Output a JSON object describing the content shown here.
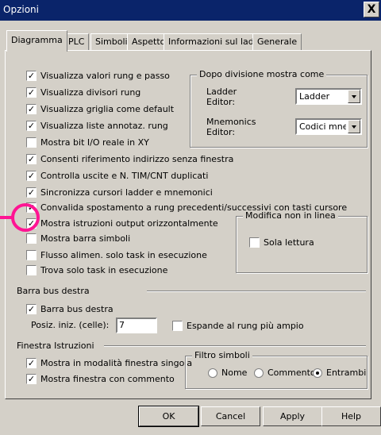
{
  "window": {
    "title": "Opzioni",
    "close_glyph": "X"
  },
  "tabs": [
    {
      "label": "Diagramma"
    },
    {
      "label": "PLC"
    },
    {
      "label": "Simboli"
    },
    {
      "label": "Aspetto"
    },
    {
      "label": "Informazioni sul ladder"
    },
    {
      "label": "Generale"
    }
  ],
  "options": [
    {
      "label": "Visualizza valori rung e passo",
      "checked": true
    },
    {
      "label": "Visualizza divisori rung",
      "checked": true
    },
    {
      "label": "Visualizza griglia come default",
      "checked": true
    },
    {
      "label": "Visualizza liste annotaz. rung",
      "checked": true
    },
    {
      "label": "Mostra bit I/O reale in XY",
      "checked": false
    },
    {
      "label": "Consenti riferimento indirizzo senza finestra",
      "checked": true
    },
    {
      "label": "Controlla uscite e N. TIM/CNT duplicati",
      "checked": true
    },
    {
      "label": "Sincronizza cursori ladder e mnemonici",
      "checked": true
    },
    {
      "label": "Convalida spostamento a rung precedenti/successivi con tasti cursore",
      "checked": true
    },
    {
      "label": "Mostra istruzioni output orizzontalmente",
      "checked": true
    },
    {
      "label": "Mostra barra simboli",
      "checked": false
    },
    {
      "label": "Flusso alimen. solo task in esecuzione",
      "checked": false
    },
    {
      "label": "Trova solo task in esecuzione",
      "checked": false
    }
  ],
  "after_split": {
    "title": "Dopo divisione mostra come",
    "ladder_label_1": "Ladder",
    "ladder_label_2": "Editor:",
    "ladder_value": "Ladder",
    "mnem_label_1": "Mnemonics",
    "mnem_label_2": "Editor:",
    "mnem_value": "Codici mnemor"
  },
  "offline_edit": {
    "title": "Modifica non in linea",
    "read_only_label": "Sola lettura",
    "read_only_checked": false
  },
  "bus_bar": {
    "section_label": "Barra bus destra",
    "checkbox_label": "Barra bus destra",
    "checked": true,
    "initial_pos_label": "Posiz. iniz. (celle):",
    "initial_pos_value": "7",
    "expand_label": "Espande al rung più ampio",
    "expand_checked": false
  },
  "instructions_window": {
    "section_label": "Finestra Istruzioni",
    "single_mode_label": "Mostra in modalità finestra singola",
    "single_mode_checked": true,
    "with_comment_label": "Mostra finestra con commento",
    "with_comment_checked": true
  },
  "symbol_filter": {
    "title": "Filtro simboli",
    "options": [
      "Nome",
      "Commento",
      "Entrambi"
    ],
    "selected": "Entrambi"
  },
  "buttons": {
    "ok": "OK",
    "cancel": "Cancel",
    "apply": "Apply",
    "help": "Help"
  },
  "colors": {
    "titlebar": "#0a246a",
    "dialog": "#d4d0c8",
    "highlight": "#ff1493"
  }
}
